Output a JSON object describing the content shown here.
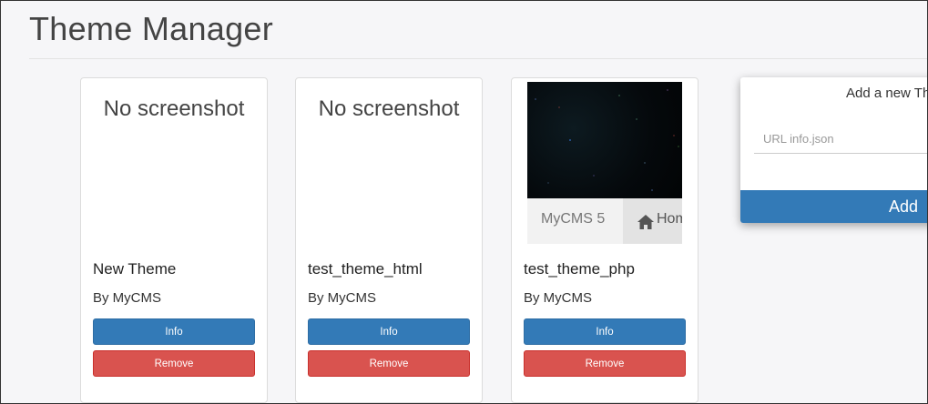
{
  "header": {
    "title": "Theme Manager"
  },
  "themes": [
    {
      "screenshot_text": "No screenshot",
      "name": "New Theme",
      "author": "By MyCMS",
      "info_label": "Info",
      "remove_label": "Remove"
    },
    {
      "screenshot_text": "No screenshot",
      "name": "test_theme_html",
      "author": "By MyCMS",
      "info_label": "Info",
      "remove_label": "Remove"
    },
    {
      "preview": {
        "brand": "MyCMS 5",
        "home_label": "Home"
      },
      "name": "test_theme_php",
      "author": "By MyCMS",
      "info_label": "Info",
      "remove_label": "Remove"
    }
  ],
  "add_panel": {
    "title": "Add a new Theme",
    "url_placeholder": "URL info.json",
    "url_value": "",
    "add_label": "Add"
  },
  "colors": {
    "primary": "#337ab7",
    "danger": "#d9534f",
    "background": "#f6f6f8"
  }
}
